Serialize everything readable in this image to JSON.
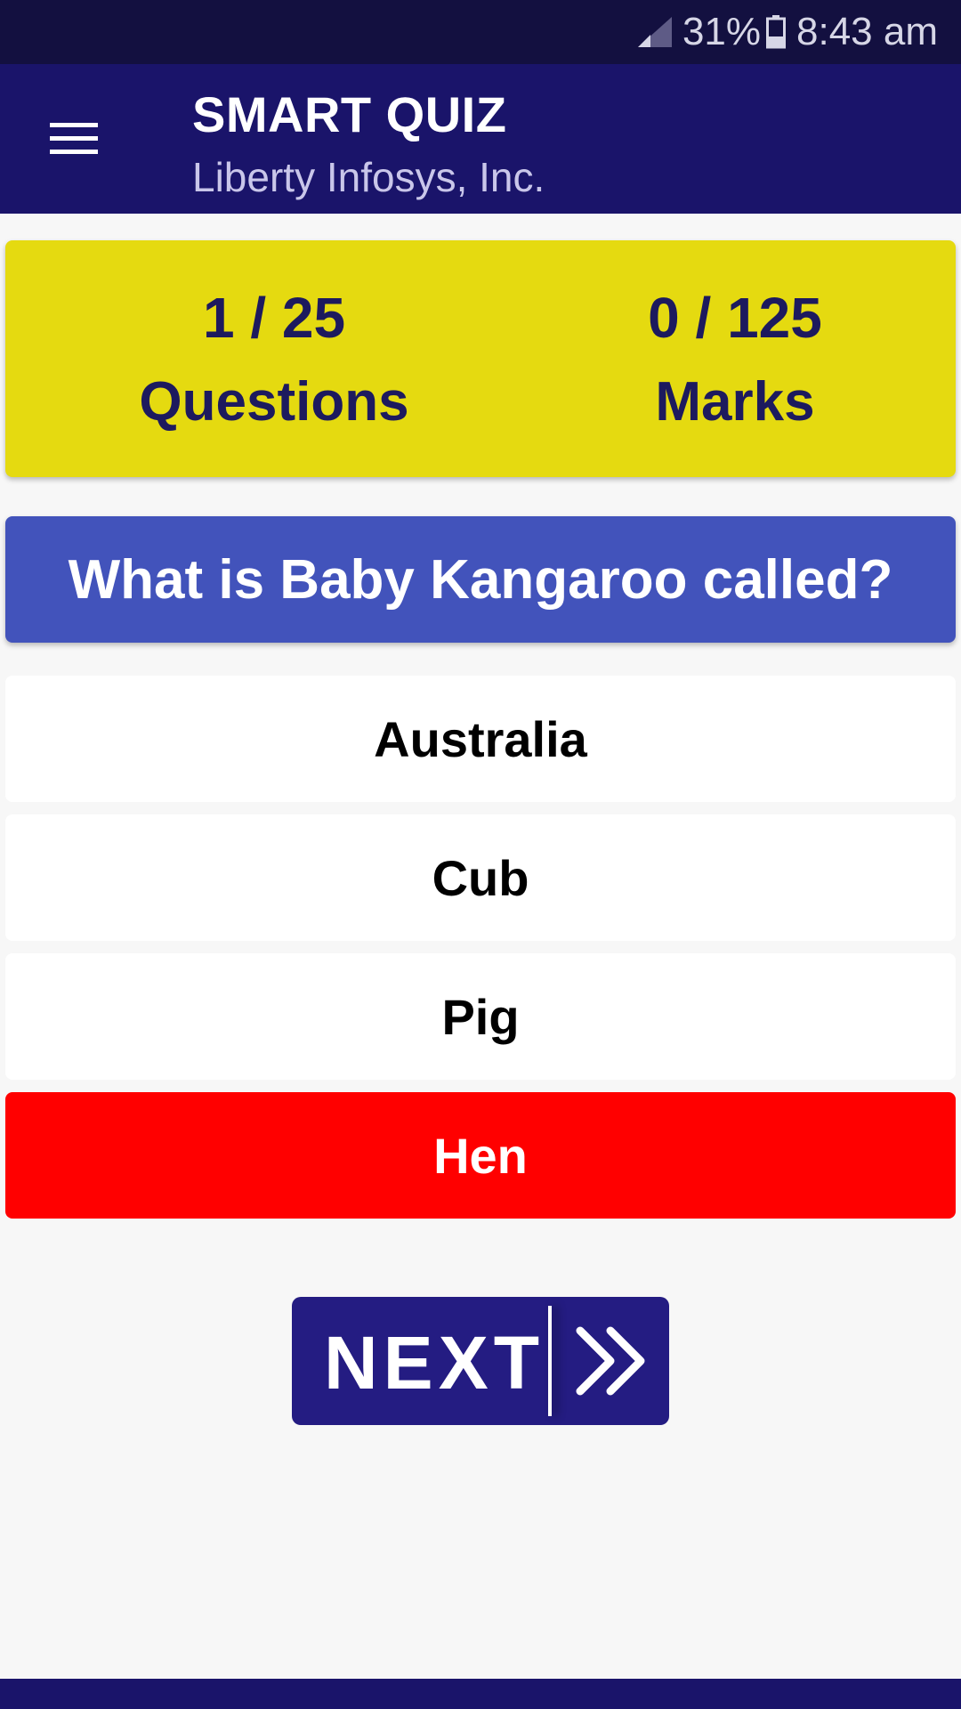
{
  "status_bar": {
    "battery_percent": "31%",
    "time": "8:43 am",
    "icons": [
      "signal-icon",
      "battery-icon"
    ]
  },
  "app_bar": {
    "title": "SMART QUIZ",
    "subtitle": "Liberty Infosys, Inc.",
    "menu_icon": "hamburger-menu-icon"
  },
  "score": {
    "questions_value": "1 / 25",
    "questions_label": "Questions",
    "marks_value": "0 / 125",
    "marks_label": "Marks"
  },
  "question": {
    "text": "What is Baby Kangaroo called?"
  },
  "options": [
    {
      "label": "Australia",
      "state": "default"
    },
    {
      "label": "Cub",
      "state": "default"
    },
    {
      "label": "Pig",
      "state": "default"
    },
    {
      "label": "Hen",
      "state": "wrong"
    }
  ],
  "next_button": {
    "label": "NEXT",
    "icon": "double-chevron-right-icon"
  },
  "colors": {
    "status_bar": "#131040",
    "app_bar": "#1a146a",
    "score_card": "#e5da10",
    "score_text": "#1d1a5e",
    "question_card": "#4253bb",
    "wrong_option": "#ff0000",
    "next_button": "#241c82",
    "background": "#f7f7f7"
  }
}
